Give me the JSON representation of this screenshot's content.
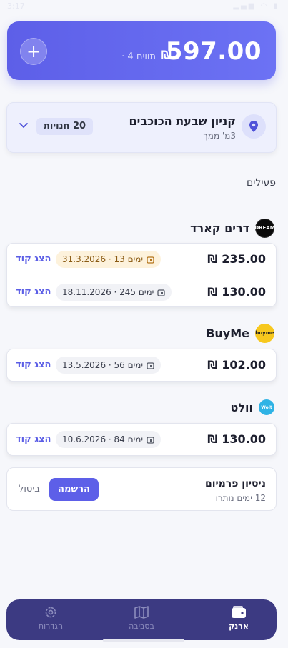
{
  "status_bar": {
    "time": "3:17"
  },
  "balance": {
    "amount": "597.00",
    "currency": "₪",
    "count_text": "· 4 תווים",
    "add_label": "+"
  },
  "mall": {
    "name": "קניון שבעת הכוכבים",
    "distance": "3מ' ממך",
    "stores_badge": "20 חנויות"
  },
  "section": {
    "active_label": "פעילים"
  },
  "vendors": [
    {
      "name": "דרים קארד",
      "logo_text": "DREAM",
      "logo_color": "#0b0b0b",
      "cards": [
        {
          "amount": "235.00 ₪",
          "expiry": "31.3.2026 · 13 ימים",
          "show_label": "הצג קוד",
          "warning": true
        },
        {
          "amount": "130.00 ₪",
          "expiry": "18.11.2026 · 245 ימים",
          "show_label": "הצג קוד",
          "warning": false
        }
      ]
    },
    {
      "name": "BuyMe",
      "logo_text": "buyme",
      "logo_color": "#f7c81e",
      "cards": [
        {
          "amount": "102.00 ₪",
          "expiry": "13.5.2026 · 56 ימים",
          "show_label": "הצג קוד",
          "warning": false
        }
      ]
    },
    {
      "name": "וולט",
      "logo_text": "Wolt",
      "logo_color": "#2fb3e5",
      "cards": [
        {
          "amount": "130.00 ₪",
          "expiry": "10.6.2026 · 84 ימים",
          "show_label": "הצג קוד",
          "warning": false
        }
      ]
    }
  ],
  "trial": {
    "title": "ניסיון פרמיום",
    "remaining": "12 ימים נותרו",
    "signup_label": "הרשמה",
    "cancel_label": "ביטול"
  },
  "nav": {
    "wallet": "ארנק",
    "nearby": "בסביבה",
    "settings": "הגדרות"
  },
  "colors": {
    "accent": "#5d5fe8",
    "nav_bg": "#3c3a82",
    "warning_bg": "#fdf2dc"
  }
}
